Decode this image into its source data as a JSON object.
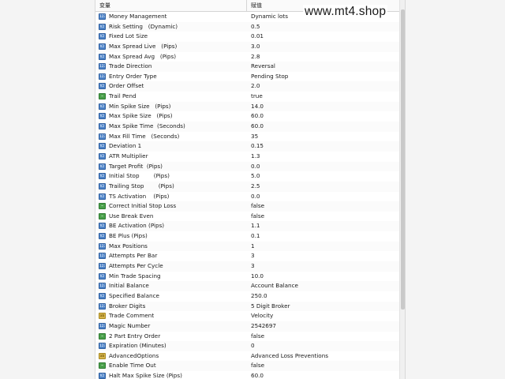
{
  "header": {
    "variable_label": "变量",
    "value_label": "赋值"
  },
  "watermark": "www.mt4.shop",
  "rows": [
    {
      "icon": "blue",
      "icon_name": "enum-icon",
      "icon_text": "123",
      "name": "Money Management",
      "value": "Dynamic lots"
    },
    {
      "icon": "blue",
      "icon_name": "double-icon",
      "icon_text": "V2",
      "name": "Risk Setting   (Dynamic)",
      "value": "0.5"
    },
    {
      "icon": "blue",
      "icon_name": "double-icon",
      "icon_text": "V2",
      "name": "Fixed Lot Size",
      "value": "0.01"
    },
    {
      "icon": "blue",
      "icon_name": "double-icon",
      "icon_text": "V2",
      "name": "Max Spread Live   (Pips)",
      "value": "3.0"
    },
    {
      "icon": "blue",
      "icon_name": "double-icon",
      "icon_text": "V2",
      "name": "Max Spread Avg   (Pips)",
      "value": "2.8"
    },
    {
      "icon": "blue",
      "icon_name": "enum-icon",
      "icon_text": "123",
      "name": "Trade Direction",
      "value": "Reversal"
    },
    {
      "icon": "blue",
      "icon_name": "enum-icon",
      "icon_text": "123",
      "name": "Entry Order Type",
      "value": "Pending Stop"
    },
    {
      "icon": "blue",
      "icon_name": "double-icon",
      "icon_text": "V2",
      "name": "Order Offset",
      "value": "2.0"
    },
    {
      "icon": "green",
      "icon_name": "bool-icon",
      "icon_text": "~",
      "name": "Trail Pend",
      "value": "true"
    },
    {
      "icon": "blue",
      "icon_name": "double-icon",
      "icon_text": "V2",
      "name": "Min Spike Size   (Pips)",
      "value": "14.0"
    },
    {
      "icon": "blue",
      "icon_name": "double-icon",
      "icon_text": "V2",
      "name": "Max Spike Size   (Pips)",
      "value": "60.0"
    },
    {
      "icon": "blue",
      "icon_name": "double-icon",
      "icon_text": "V2",
      "name": "Max Spike Time  (Seconds)",
      "value": "60.0"
    },
    {
      "icon": "blue",
      "icon_name": "int-icon",
      "icon_text": "123",
      "name": "Max Fill Time   (Seconds)",
      "value": "35"
    },
    {
      "icon": "blue",
      "icon_name": "double-icon",
      "icon_text": "V2",
      "name": "Deviation 1",
      "value": "0.15"
    },
    {
      "icon": "blue",
      "icon_name": "double-icon",
      "icon_text": "V2",
      "name": "ATR Multiplier",
      "value": "1.3"
    },
    {
      "icon": "blue",
      "icon_name": "double-icon",
      "icon_text": "V2",
      "name": "Target Profit  (Pips)",
      "value": "0.0"
    },
    {
      "icon": "blue",
      "icon_name": "double-icon",
      "icon_text": "V2",
      "name": "Initial Stop        (Pips)",
      "value": "5.0"
    },
    {
      "icon": "blue",
      "icon_name": "double-icon",
      "icon_text": "V2",
      "name": "Trailing Stop        (Pips)",
      "value": "2.5"
    },
    {
      "icon": "blue",
      "icon_name": "double-icon",
      "icon_text": "V2",
      "name": "TS Activation    (Pips)",
      "value": "0.0"
    },
    {
      "icon": "green",
      "icon_name": "bool-icon",
      "icon_text": "~",
      "name": "Correct Initial Stop Loss",
      "value": "false"
    },
    {
      "icon": "green",
      "icon_name": "bool-icon",
      "icon_text": "~",
      "name": "Use Break Even",
      "value": "false"
    },
    {
      "icon": "blue",
      "icon_name": "double-icon",
      "icon_text": "V2",
      "name": "BE Activation (Pips)",
      "value": "1.1"
    },
    {
      "icon": "blue",
      "icon_name": "double-icon",
      "icon_text": "V2",
      "name": "BE Plus (Pips)",
      "value": "0.1"
    },
    {
      "icon": "blue",
      "icon_name": "int-icon",
      "icon_text": "123",
      "name": "Max Positions",
      "value": "1"
    },
    {
      "icon": "blue",
      "icon_name": "int-icon",
      "icon_text": "123",
      "name": "Attempts Per Bar",
      "value": "3"
    },
    {
      "icon": "blue",
      "icon_name": "int-icon",
      "icon_text": "123",
      "name": "Attempts Per Cycle",
      "value": "3"
    },
    {
      "icon": "blue",
      "icon_name": "double-icon",
      "icon_text": "V2",
      "name": "Min Trade Spacing",
      "value": "10.0"
    },
    {
      "icon": "blue",
      "icon_name": "enum-icon",
      "icon_text": "123",
      "name": "Initial Balance",
      "value": "Account Balance"
    },
    {
      "icon": "blue",
      "icon_name": "double-icon",
      "icon_text": "V2",
      "name": "Specified Balance",
      "value": "250.0"
    },
    {
      "icon": "blue",
      "icon_name": "enum-icon",
      "icon_text": "123",
      "name": "Broker Digits",
      "value": "5 Digit Broker"
    },
    {
      "icon": "gold",
      "icon_name": "string-icon",
      "icon_text": "ab",
      "name": "Trade Comment",
      "value": "Velocity"
    },
    {
      "icon": "blue",
      "icon_name": "int-icon",
      "icon_text": "123",
      "name": "Magic Number",
      "value": "2542697"
    },
    {
      "icon": "green",
      "icon_name": "bool-icon",
      "icon_text": "~",
      "name": "2 Part Entry Order",
      "value": "false"
    },
    {
      "icon": "blue",
      "icon_name": "int-icon",
      "icon_text": "123",
      "name": "Expiration (Minutes)",
      "value": "0"
    },
    {
      "icon": "gold",
      "icon_name": "string-icon",
      "icon_text": "ab",
      "name": "AdvancedOptions",
      "value": "Advanced Loss Preventions"
    },
    {
      "icon": "green",
      "icon_name": "bool-icon",
      "icon_text": "~",
      "name": "Enable Time Out",
      "value": "false"
    },
    {
      "icon": "blue",
      "icon_name": "double-icon",
      "icon_text": "V2",
      "name": "Halt Max Spike Size (Pips)",
      "value": "60.0"
    }
  ]
}
